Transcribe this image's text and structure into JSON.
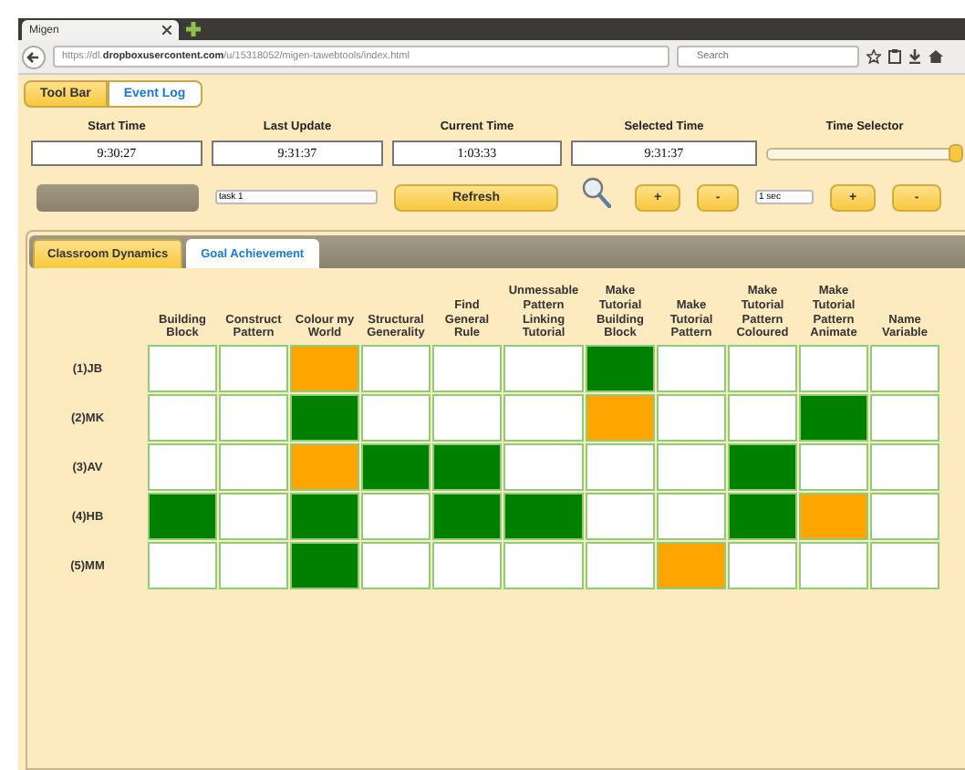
{
  "browser": {
    "tab_title": "Migen",
    "url": "https://dl.**dropboxusercontent.com**/u/15318052/migen-tawebtools/index.html",
    "search_placeholder": "Search"
  },
  "view_tabs": [
    {
      "label": "Tool Bar",
      "selected": true
    },
    {
      "label": "Event Log",
      "selected": false
    }
  ],
  "time_fields": [
    {
      "label": "Start Time",
      "value": "9:30:27"
    },
    {
      "label": "Last Update",
      "value": "9:31:37"
    },
    {
      "label": "Current Time",
      "value": "1:03:33"
    },
    {
      "label": "Selected Time",
      "value": "9:31:37"
    }
  ],
  "time_selector": {
    "label": "Time Selector",
    "level": 1
  },
  "task_select": "task 1",
  "refresh": "Refresh",
  "zoom_plus": "+",
  "zoom_minus": "-",
  "step_select": "1 sec",
  "step_plus": "+",
  "step_minus": "-",
  "panel_tabs": [
    {
      "label": "Classroom Dynamics",
      "selected": false
    },
    {
      "label": "Goal Achievement",
      "selected": true
    }
  ],
  "table": {
    "columns": [
      "Building Block",
      "Construct Pattern",
      "Colour my World",
      "Structural Generality",
      "Find General Rule",
      "Unmessable Pattern Linking Tutorial",
      "Make Tutorial Building Block",
      "Make Tutorial Pattern",
      "Make Tutorial Pattern Coloured",
      "Make Tutorial Pattern Animate",
      "Name Variable"
    ],
    "rows": [
      {
        "label": "(1)JB",
        "cells": [
          {
            "color": "#ffffff"
          },
          {
            "color": "#ffffff"
          },
          {
            "color": "#ffa500"
          },
          {
            "color": "#ffffff"
          },
          {
            "color": "#ffffff"
          },
          {
            "color": "#ffffff"
          },
          {
            "color": "#008000"
          },
          {
            "color": "#ffffff"
          },
          {
            "color": "#ffffff"
          },
          {
            "color": "#ffffff"
          },
          {
            "color": "#ffffff"
          }
        ]
      },
      {
        "label": "(2)MK",
        "cells": [
          {
            "color": "#ffffff"
          },
          {
            "color": "#ffffff"
          },
          {
            "color": "#008000"
          },
          {
            "color": "#ffffff"
          },
          {
            "color": "#ffffff"
          },
          {
            "color": "#ffffff"
          },
          {
            "color": "#ffa500"
          },
          {
            "color": "#ffffff"
          },
          {
            "color": "#ffffff"
          },
          {
            "color": "#008000"
          },
          {
            "color": "#ffffff"
          }
        ]
      },
      {
        "label": "(3)AV",
        "cells": [
          {
            "color": "#ffffff"
          },
          {
            "color": "#ffffff"
          },
          {
            "color": "#ffa500"
          },
          {
            "color": "#008000"
          },
          {
            "color": "#008000"
          },
          {
            "color": "#ffffff"
          },
          {
            "color": "#ffffff"
          },
          {
            "color": "#ffffff"
          },
          {
            "color": "#008000"
          },
          {
            "color": "#ffffff"
          },
          {
            "color": "#ffffff"
          }
        ]
      },
      {
        "label": "(4)HB",
        "cells": [
          {
            "color": "#008000"
          },
          {
            "color": "#ffffff"
          },
          {
            "color": "#008000"
          },
          {
            "color": "#ffffff"
          },
          {
            "color": "#008000"
          },
          {
            "color": "#008000"
          },
          {
            "color": "#ffffff"
          },
          {
            "color": "#ffffff"
          },
          {
            "color": "#008000"
          },
          {
            "color": "#ffa500"
          },
          {
            "color": "#ffffff"
          }
        ]
      },
      {
        "label": "(5)MM",
        "cells": [
          {
            "color": "#ffffff"
          },
          {
            "color": "#ffffff"
          },
          {
            "color": "#008000"
          },
          {
            "color": "#ffffff"
          },
          {
            "color": "#ffffff"
          },
          {
            "color": "#ffffff"
          },
          {
            "color": "#ffffff"
          },
          {
            "color": "#ffa500"
          },
          {
            "color": "#ffffff"
          },
          {
            "color": "#ffffff"
          },
          {
            "color": "#ffffff"
          }
        ]
      }
    ]
  }
}
